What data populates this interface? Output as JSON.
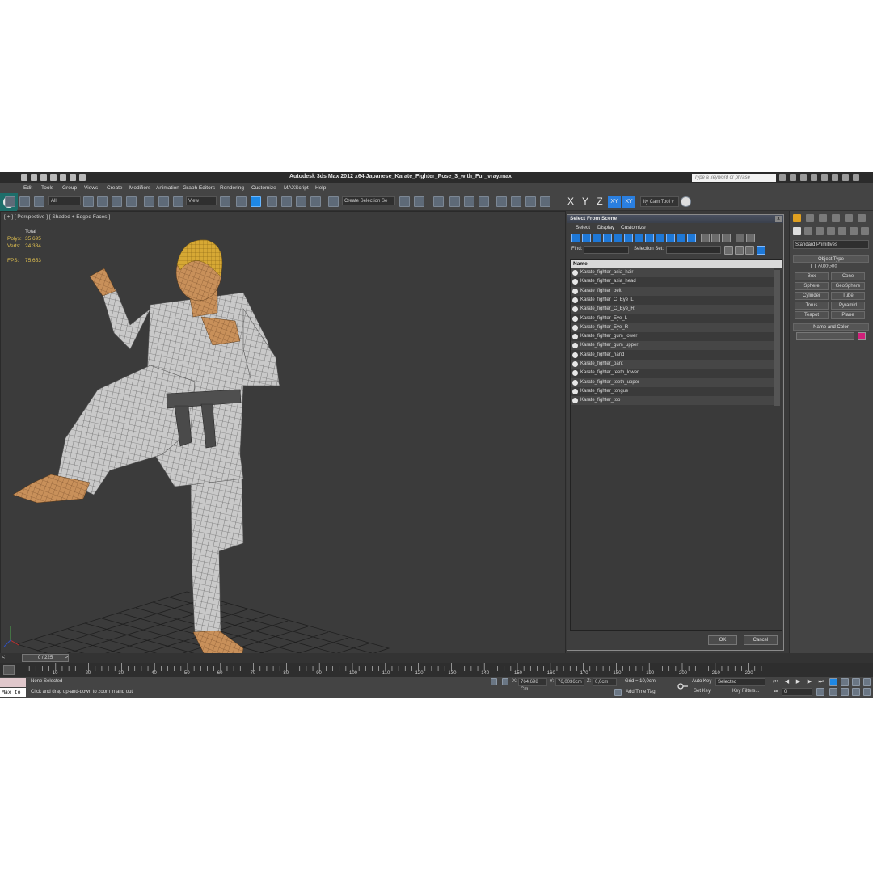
{
  "window": {
    "title": "Autodesk 3ds Max  2012 x64     Japanese_Karate_Fighter_Pose_3_with_Fur_vray.max",
    "search_placeholder": "Type a keyword or phrase"
  },
  "menu": [
    "Edit",
    "Tools",
    "Group",
    "Views",
    "Create",
    "Modifiers",
    "Animation",
    "Graph Editors",
    "Rendering",
    "Customize",
    "MAXScript",
    "Help"
  ],
  "toolbar": {
    "selection_filter": "All",
    "reference_coord": "View",
    "named_selection": "Create Selection Se",
    "axes": [
      "X",
      "Y",
      "Z",
      "XY",
      "XY"
    ],
    "cam_tool": "ity Cam Tool v"
  },
  "viewport": {
    "label": "[ + ] [ Perspective ] [ Shaded + Edged Faces ]",
    "stats": {
      "header": "Total",
      "polys_label": "Polys:",
      "polys": "35 695",
      "verts_label": "Verts:",
      "verts": "24 384",
      "fps_label": "FPS:",
      "fps": "75,653"
    }
  },
  "select_from_scene": {
    "title": "Select From Scene",
    "close": "x",
    "menu": [
      "Select",
      "Display",
      "Customize"
    ],
    "find_label": "Find:",
    "selection_set_label": "Selection Set:",
    "column_header": "Name",
    "objects": [
      "Karate_fighter_asia_hair",
      "Karate_fighter_asia_head",
      "Karate_fighter_belt",
      "Karate_fighter_C_Eye_L",
      "Karate_fighter_C_Eye_R",
      "Karate_fighter_Eye_L",
      "Karate_fighter_Eye_R",
      "Karate_fighter_gum_lower",
      "Karate_fighter_gum_upper",
      "Karate_fighter_hand",
      "Karate_fighter_pant",
      "Karate_fighter_teeth_lower",
      "Karate_fighter_teeth_upper",
      "Karate_fighter_tongue",
      "Karate_fighter_top"
    ],
    "ok": "OK",
    "cancel": "Cancel"
  },
  "command_panel": {
    "category": "Standard Primitives",
    "object_type_title": "Object Type",
    "autogrid": "AutoGrid",
    "primitives": [
      "Box",
      "Cone",
      "Sphere",
      "GeoSphere",
      "Cylinder",
      "Tube",
      "Torus",
      "Pyramid",
      "Teapot",
      "Plane"
    ],
    "name_color_title": "Name and Color",
    "object_color": "#d0207a"
  },
  "timeline": {
    "frame_display": "0 / 225",
    "ticks": [
      "10",
      "20",
      "30",
      "40",
      "50",
      "60",
      "70",
      "80",
      "90",
      "100",
      "110",
      "120",
      "130",
      "140",
      "150",
      "160",
      "170",
      "180",
      "190",
      "200",
      "210",
      "220"
    ]
  },
  "status": {
    "maxscript": "Max to",
    "selection": "None Selected",
    "prompt": "Click and drag up-and-down to zoom in and out",
    "x_label": "X:",
    "x": "764,698 Cm",
    "y_label": "Y:",
    "y": "76,0036cm",
    "z_label": "Z:",
    "z": "0,0cm",
    "grid": "Grid = 10,0cm",
    "auto_key": "Auto Key",
    "set_key": "Set Key",
    "key_mode": "Selected",
    "key_filters": "Key Filters...",
    "add_time_tag": "Add Time Tag",
    "current_frame": "0"
  }
}
